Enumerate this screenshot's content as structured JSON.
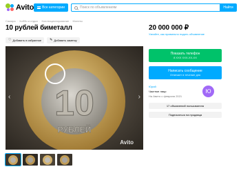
{
  "header": {
    "logo_text": "Avito",
    "categories_label": "Все категории",
    "search_placeholder": "Поиск по объявлениям",
    "find_label": "Найти"
  },
  "breadcrumb": [
    "Самара",
    "Хобби и отдых",
    "Коллекционирование",
    "Монеты"
  ],
  "title": "10 рублей биметалл",
  "actions": {
    "favorite_label": "Добавить в избранное",
    "note_label": "Добавить заметку"
  },
  "price": {
    "value": "20 000 000 ₽",
    "sub": "Узнайте, как правильно подать объявление"
  },
  "main_image": {
    "watermark": "Avito"
  },
  "phone_button": {
    "label": "Показать телефон",
    "sub": "8 XXX XXX-XX-XX"
  },
  "message_button": {
    "label": "Написать сообщение",
    "sub": "Отвечает в течение дня"
  },
  "seller": {
    "name": "Юрий",
    "type": "Частное лицо",
    "since": "На Авито с февраля 2021",
    "avatar_letter": "Ю"
  },
  "seller_buttons": {
    "ads_label": "17 объявлений пользователя",
    "subscribe_label": "Подписаться на продавца"
  },
  "colors": {
    "accent": "#00aaff",
    "green": "#00c26a",
    "avatar": "#a169f7"
  }
}
